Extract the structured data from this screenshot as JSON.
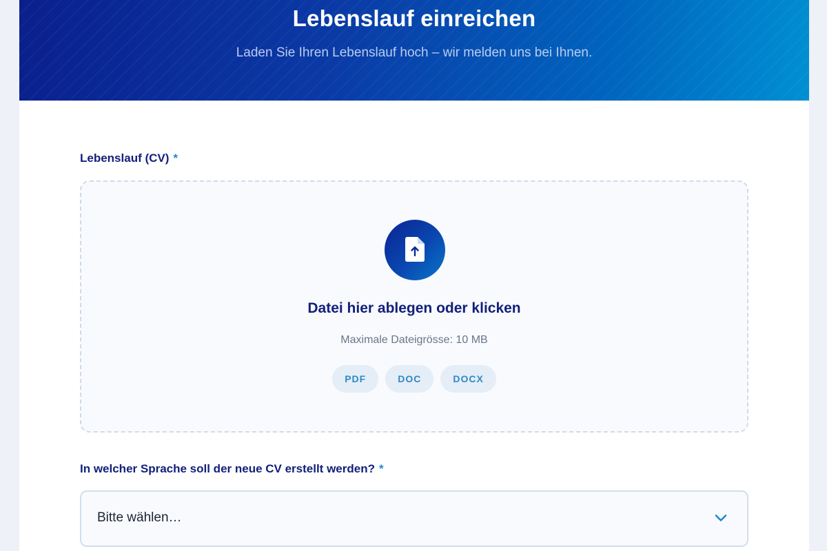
{
  "header": {
    "title": "Lebenslauf einreichen",
    "subtitle": "Laden Sie Ihren Lebenslauf hoch – wir melden uns bei Ihnen."
  },
  "cv_field": {
    "label": "Lebenslauf (CV)",
    "required_mark": "*",
    "upload_icon": "file-upload-icon",
    "dropzone_title": "Datei hier ablegen oder klicken",
    "max_size_hint": "Maximale Dateigrösse: 10 MB",
    "formats": [
      "PDF",
      "DOC",
      "DOCX"
    ]
  },
  "language_field": {
    "label": "In welcher Sprache soll der neue CV erstellt werden?",
    "required_mark": "*",
    "selected_value": "Bitte wählen…",
    "chevron_icon": "chevron-down-icon"
  },
  "colors": {
    "brand_dark": "#13207a",
    "accent": "#1f8ac9",
    "hero_start": "#0a1f8c",
    "hero_end": "#0090d2"
  }
}
